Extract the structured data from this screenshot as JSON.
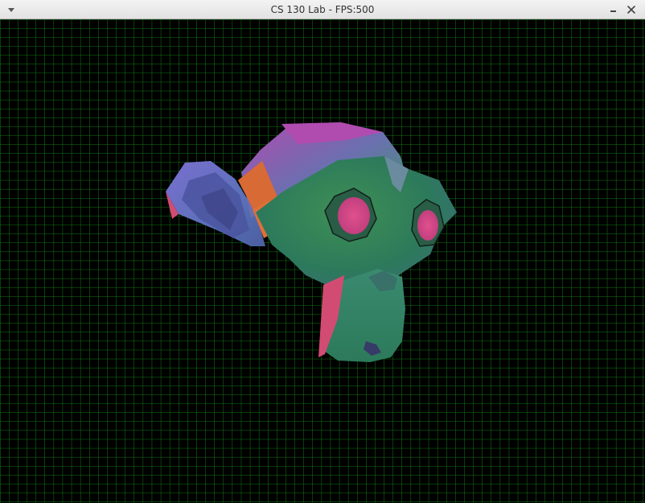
{
  "window": {
    "title": "CS 130 Lab - FPS:500",
    "menu_icon": "chevron-down-icon",
    "minimize_icon": "minimize-icon",
    "close_icon": "close-icon"
  },
  "scene": {
    "background_color": "#000000",
    "grid_color": "#0f7a12",
    "object": "textured-monkey-head"
  }
}
